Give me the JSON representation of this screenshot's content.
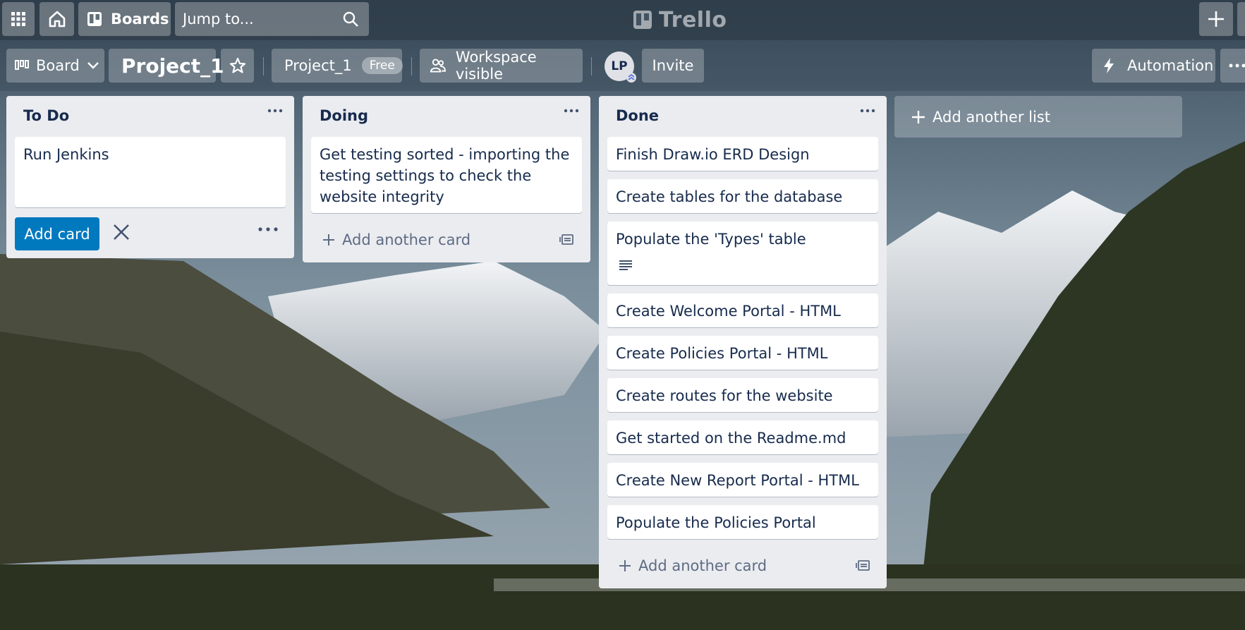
{
  "topnav": {
    "boards_label": "Boards",
    "search_placeholder": "Jump to...",
    "logo_text": "Trello"
  },
  "board_header": {
    "view_label": "Board",
    "board_title": "Project_1",
    "workspace_name": "Project_1",
    "workspace_plan": "Free",
    "visibility_label": "Workspace visible",
    "member_initials": "LP",
    "invite_label": "Invite",
    "automation_label": "Automation"
  },
  "lists": [
    {
      "title": "To Do",
      "composer_text": "Run Jenkins",
      "add_card_label": "Add card"
    },
    {
      "title": "Doing",
      "cards": [
        "Get testing sorted - importing the testing settings to check the website integrity"
      ],
      "add_another_label": "Add another card"
    },
    {
      "title": "Done",
      "cards": [
        "Finish Draw.io ERD Design",
        "Create tables for the database",
        "Populate the 'Types' table",
        "Create Welcome Portal - HTML",
        "Create Policies Portal - HTML",
        "Create routes for the website",
        "Get started on the Readme.md",
        "Create New Report Portal - HTML",
        "Populate the Policies Portal"
      ],
      "add_another_label": "Add another card"
    }
  ],
  "add_list_label": "Add another list",
  "icons": [
    "apps-grid-icon",
    "home-icon",
    "boards-icon",
    "search-icon",
    "trello-logo-icon",
    "plus-icon",
    "board-view-icon",
    "chevron-down-icon",
    "star-icon",
    "people-icon",
    "lightning-icon",
    "more-icon",
    "close-icon",
    "card-template-icon",
    "description-icon"
  ],
  "colors": {
    "accent": "#0079bf",
    "list_bg": "#ebecf0",
    "text": "#172b4d",
    "muted": "#5e6c84"
  }
}
